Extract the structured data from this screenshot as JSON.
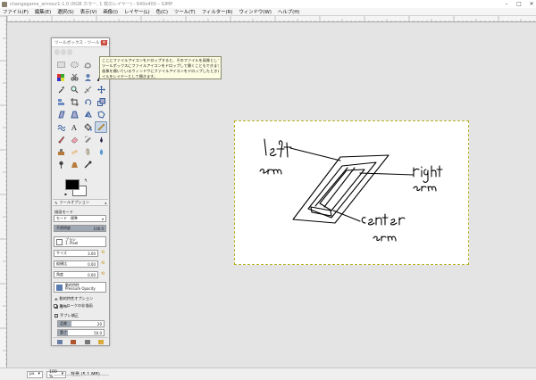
{
  "window": {
    "title": "changegame_armour1-1.0 (RGB カラー, 1 枚のレイヤー) - 640x400 – GIMP"
  },
  "menu": {
    "items": [
      "ファイル(F)",
      "編集(E)",
      "選択(S)",
      "表示(V)",
      "画像(I)",
      "レイヤー(L)",
      "色(C)",
      "ツール(T)",
      "フィルター(R)",
      "ウィンドウ(W)",
      "ヘルプ(H)"
    ]
  },
  "toolbox": {
    "title": "ツールボックス - ツールオプ...",
    "tooltip": [
      "ここにファイルアイコンをドロップすると、そのファイルを画像として開きます。",
      "ツールボックスにファイルアイコンをドロップして開くこともできます。",
      "画像を開いているウィンドウにファイルアイコンをドロップしたときは、そのファ",
      "イルをレイヤーとして開きます。"
    ],
    "options_tab_label": "ツールオプション",
    "options": {
      "mode_label": "描画モード",
      "mode_key": "モード",
      "mode_value": "標準",
      "opacity_label": "不透明度",
      "opacity_value": "100.0",
      "opacity_fraction": 1.0,
      "brush_label": "ブラシ",
      "brush_value": "1. Pixel",
      "size_label": "サイズ",
      "size_value": "3.00",
      "aspect_label": "縦横比",
      "aspect_value": "0.00",
      "angle_label": "角度",
      "angle_value": "0.00",
      "dynamics_label": "動的特性",
      "dynamics_value": "Pressure Opacity",
      "dynamics_options_label": "動的特性オプション",
      "jitter_label": "散布",
      "smooth_label": "手ブレ補正",
      "smooth_quality_label": "品質",
      "smooth_quality_value": "20",
      "smooth_weight_label": "重さ",
      "smooth_weight_value": "50.0",
      "incremental_label": "ストロークの非描画"
    }
  },
  "status": {
    "unit": "px",
    "zoom": "100 %",
    "text": "背景 (5.1 MB)"
  },
  "sketch": {
    "labels": [
      "left",
      "arm",
      "right",
      "arm",
      "center",
      "arm"
    ],
    "stroke_color": "#000000"
  },
  "colors": {
    "canvas_border": "#b7b22a",
    "tooltip_bg": "#fdfde3",
    "close_button": "#c94a3c"
  },
  "icons": [
    "new-image-icon",
    "open-icon",
    "save-icon",
    "pencil-icon"
  ]
}
